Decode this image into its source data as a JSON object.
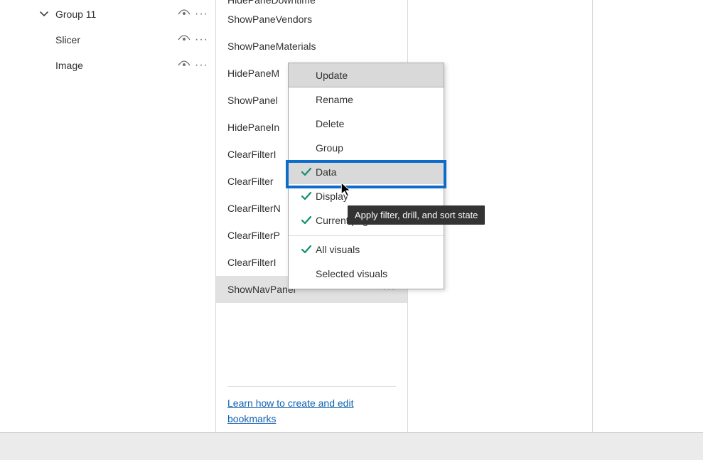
{
  "selection_pane": {
    "items": [
      {
        "label": "Group 11",
        "expanded": true
      },
      {
        "label": "Slicer"
      },
      {
        "label": "Image"
      }
    ]
  },
  "bookmarks": [
    "HidePaneDowntime",
    "ShowPaneVendors",
    "ShowPaneMaterials",
    "HidePaneM",
    "ShowPanel",
    "HidePaneIn",
    "ClearFilterI",
    "ClearFilter",
    "ClearFilterN",
    "ClearFilterP",
    "ClearFilterI",
    "ShowNavPanel"
  ],
  "bookmarks_selected_index": 11,
  "context_menu": {
    "items": [
      {
        "label": "Update",
        "highlighted": true
      },
      {
        "label": "Rename"
      },
      {
        "label": "Delete"
      },
      {
        "label": "Group"
      }
    ],
    "toggles_top": [
      {
        "label": "Data",
        "checked": true,
        "hovered": true,
        "boxed": true
      },
      {
        "label": "Display",
        "checked": true
      },
      {
        "label": "Current page",
        "checked": true
      }
    ],
    "toggles_bottom": [
      {
        "label": "All visuals",
        "checked": true
      },
      {
        "label": "Selected visuals",
        "checked": false
      }
    ]
  },
  "tooltip": "Apply filter, drill, and sort state",
  "learn_link": "Learn how to create and edit bookmarks"
}
